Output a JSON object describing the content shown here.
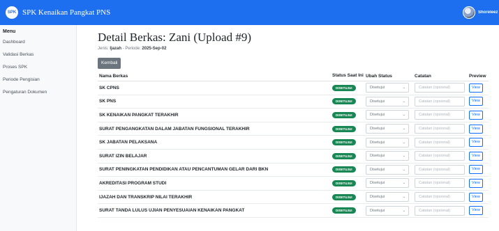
{
  "navbar": {
    "logo_text": "SPK",
    "title": "SPK Kenaikan Pangkat PNS",
    "user_name": "Shoreleez"
  },
  "sidebar": {
    "heading": "Menu",
    "items": [
      {
        "label": "Dashboard"
      },
      {
        "label": "Validasi Berkas"
      },
      {
        "label": "Proses SPK"
      },
      {
        "label": "Periode Pengisian"
      },
      {
        "label": "Pengaturan Dokumen"
      }
    ]
  },
  "main": {
    "title": "Detail Berkas: Zani (Upload #9)",
    "jenis_label": "Jenis:",
    "jenis_value": "Ijazah",
    "periode_label": "- Periode:",
    "periode_value": "2025-Sep-02",
    "back_label": "Kembali"
  },
  "table": {
    "headers": {
      "name": "Nama Berkas",
      "status": "Status Saat Ini",
      "ubah": "Ubah Status",
      "catatan": "Catatan",
      "preview": "Preview"
    },
    "status_badge": "DISETUJUI",
    "select_value": "Disetujui",
    "note_placeholder": "Catatan (opsional)",
    "view_label": "View",
    "status_color": "#198754",
    "rows": [
      {
        "name": "SK CPNS"
      },
      {
        "name": "SK PNS"
      },
      {
        "name": "SK KENAIKAN PANGKAT TERAKHIR"
      },
      {
        "name": "SURAT PENGANGKATAN DALAM JABATAN FUNGSIONAL TERAKHIR"
      },
      {
        "name": "SK JABATAN PELAKSANA"
      },
      {
        "name": "SURAT IZIN BELAJAR"
      },
      {
        "name": "SURAT PENINGKATAN PENDIDIKAN ATAU PENCANTUMAN GELAR DARI BKN"
      },
      {
        "name": "AKREDITASI PROGRAM STUDI"
      },
      {
        "name": "IJAZAH DAN TRANSKRIP NILAI TERAKHIR"
      },
      {
        "name": "SURAT TANDA LULUS UJIAN PENYESUAIAN KENAIKAN PANGKAT"
      }
    ]
  }
}
